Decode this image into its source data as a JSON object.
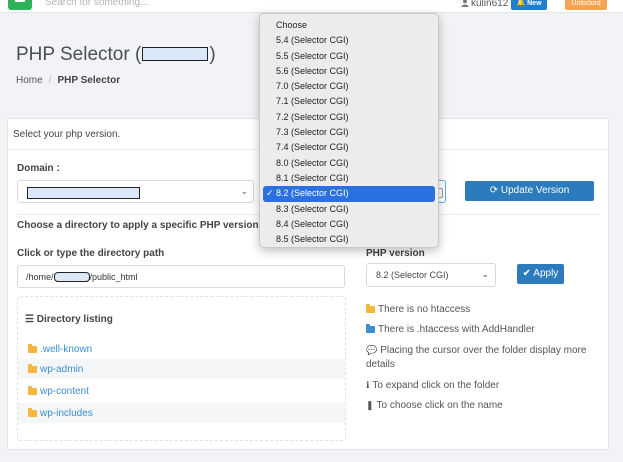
{
  "topbar": {
    "search_placeholder": "Search for something...",
    "username": "kulin612",
    "new_badge": "New",
    "unlocked_badge": "Unlocked"
  },
  "page": {
    "title_prefix": "PHP Selector (",
    "title_suffix": ")",
    "breadcrumb_home": "Home",
    "breadcrumb_sep": "/",
    "breadcrumb_current": "PHP Selector"
  },
  "card": {
    "header": "Select your php version.",
    "domain_label": "Domain :",
    "update_button": "Update Version",
    "choose_directory": "Choose a directory to apply a specific PHP version.",
    "path_label": "Click or type the directory path",
    "path_prefix": "/home/",
    "path_suffix": "/public_html",
    "php_version_label": "PHP version",
    "php_version_value": "8.2 (Selector CGI)",
    "apply_button": "Apply",
    "directory_listing_title": "Directory listing",
    "directories": [
      ".well-known",
      "wp-admin",
      "wp-content",
      "wp-includes"
    ],
    "info": [
      "There is no htaccess",
      "There is .htaccess with AddHandler",
      "Placing the cursor over the folder display more",
      "details",
      "To expand click on the folder",
      "To choose click on the name"
    ]
  },
  "dropdown": {
    "options": [
      "Choose",
      "5.4 (Selector CGI)",
      "5.5 (Selector CGI)",
      "5.6 (Selector CGI)",
      "7.0 (Selector CGI)",
      "7.1 (Selector CGI)",
      "7.2 (Selector CGI)",
      "7.3 (Selector CGI)",
      "7.4 (Selector CGI)",
      "8.0 (Selector CGI)",
      "8.1 (Selector CGI)",
      "8.2 (Selector CGI)",
      "8.3 (Selector CGI)",
      "8.4 (Selector CGI)",
      "8.5 (Selector CGI)"
    ],
    "selected": "8.2 (Selector CGI)"
  },
  "colors": {
    "primary_button": "#2b7bbd",
    "new_badge": "#1e7fd1",
    "unlocked_badge": "#f5a552",
    "folder": "#f4b63f",
    "dropdown_selected": "#2a70e0"
  },
  "icons": [
    "user-icon",
    "bell-icon",
    "refresh-icon",
    "check-circle-icon",
    "list-icon",
    "folder-icon",
    "comment-icon",
    "info-icon"
  ]
}
